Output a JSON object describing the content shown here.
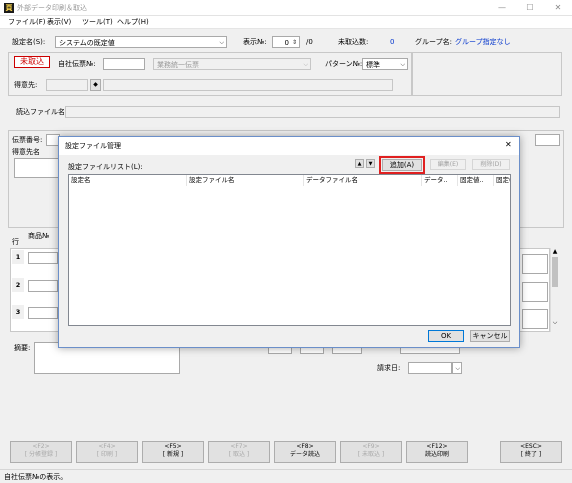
{
  "window": {
    "title": "外部データ印刷＆取込",
    "app_icon": "頁"
  },
  "menu": {
    "items": [
      "ファイル(F)",
      "表示(V)",
      "ツール(T)",
      "ヘルプ(H)"
    ]
  },
  "header": {
    "setting_name_label": "設定名(S):",
    "setting_name_value": "システムの既定値",
    "display_no_label": "表示№:",
    "display_no_value": "0",
    "display_no_total": "/0",
    "unimported_label": "未取込数:",
    "unimported_value": "0",
    "group_name_label": "グループ名:",
    "group_name_value": "グループ指定なし"
  },
  "import_section": {
    "status_badge": "未取込",
    "slip_no_label": "自社伝票№:",
    "slip_type_value": "業務統一伝票",
    "pattern_no_label": "パターン№:",
    "pattern_value": "標準",
    "customer_label": "得意先:",
    "customer_button": "◆"
  },
  "file_section": {
    "read_file_label": "読込ファイル名:"
  },
  "slip_section": {
    "slip_number_label": "伝票番号:",
    "customer_name_label": "得意先名"
  },
  "items_section": {
    "row_label": "行",
    "product_label": "商品№",
    "rows": [
      "1",
      "2",
      "3"
    ]
  },
  "footer_section": {
    "summary_label": "摘要:",
    "billing_date_label": "請求日:"
  },
  "function_keys": [
    {
      "key": "<F2>",
      "label": "[ 分帳登録 ]",
      "enabled": false
    },
    {
      "key": "<F4>",
      "label": "[ 印刷 ]",
      "enabled": false
    },
    {
      "key": "<F5>",
      "label": "[ 新規 ]",
      "enabled": true
    },
    {
      "key": "<F7>",
      "label": "[ 取込 ]",
      "enabled": false
    },
    {
      "key": "<F8>",
      "label": "データ読込",
      "enabled": true
    },
    {
      "key": "<F9>",
      "label": "[ 未取込 ]",
      "enabled": false
    },
    {
      "key": "<F12>",
      "label": "読込印刷",
      "enabled": true
    },
    {
      "key": "<ESC>",
      "label": "[ 終了 ]",
      "enabled": true
    }
  ],
  "status_bar": {
    "text": "自社伝票№の表示。"
  },
  "dialog": {
    "title": "設定ファイル管理",
    "close_glyph": "✕",
    "list_label": "設定ファイルリスト(L):",
    "add_button": "追加(A)",
    "edit_button": "編集(E)",
    "delete_button": "削除(D)",
    "columns": [
      "設定名",
      "設定ファイル名",
      "データファイル名",
      "データ..",
      "固定値..",
      "固定("
    ],
    "ok_button": "OK",
    "cancel_button": "キャンセル"
  },
  "colors": {
    "accent_red": "#cc0000",
    "group_blue": "#0033cc",
    "dialog_border": "#6b8fc9"
  }
}
